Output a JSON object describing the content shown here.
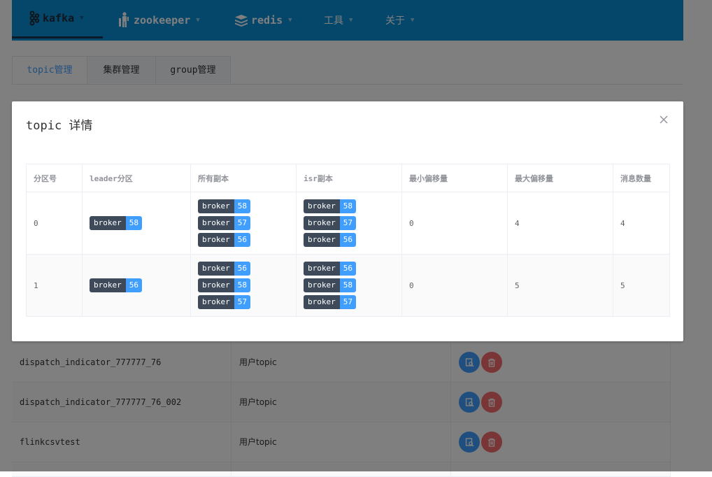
{
  "nav": {
    "items": [
      {
        "label": "kafka",
        "active": true
      },
      {
        "label": "zookeeper"
      },
      {
        "label": "redis"
      },
      {
        "label": "工具"
      },
      {
        "label": "关于"
      }
    ]
  },
  "tabs": [
    {
      "label": "topic管理",
      "active": true
    },
    {
      "label": "集群管理"
    },
    {
      "label": "group管理"
    }
  ],
  "background_table": {
    "rows": [
      {
        "name": "dispatch_indicator_777777_76",
        "type": "用户topic"
      },
      {
        "name": "dispatch_indicator_777777_76_002",
        "type": "用户topic"
      },
      {
        "name": "flinkcsvtest",
        "type": "用户topic"
      }
    ]
  },
  "dialog": {
    "title": "topic 详情",
    "columns": [
      "分区号",
      "leader分区",
      "所有副本",
      "isr副本",
      "最小偏移量",
      "最大偏移量",
      "消息数量"
    ],
    "broker_label": "broker",
    "rows": [
      {
        "partition": "0",
        "leader": "58",
        "replicas": [
          "58",
          "57",
          "56"
        ],
        "isr": [
          "58",
          "57",
          "56"
        ],
        "min_offset": "0",
        "max_offset": "4",
        "count": "4"
      },
      {
        "partition": "1",
        "leader": "56",
        "replicas": [
          "56",
          "58",
          "57"
        ],
        "isr": [
          "56",
          "58",
          "57"
        ],
        "min_offset": "0",
        "max_offset": "5",
        "count": "5"
      }
    ]
  }
}
